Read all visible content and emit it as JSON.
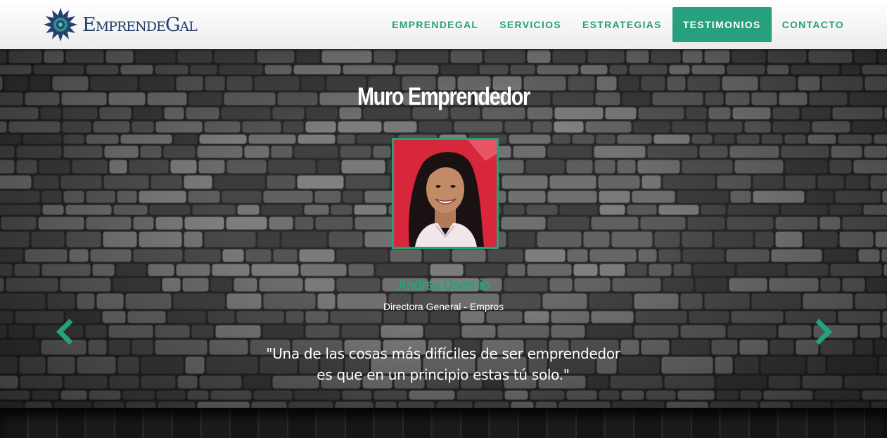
{
  "brand": {
    "name": "EmprendeGal",
    "logo_icon": "mandala-logo-icon"
  },
  "nav": {
    "items": [
      {
        "label": "EMPRENDEGAL",
        "active": false
      },
      {
        "label": "SERVICIOS",
        "active": false
      },
      {
        "label": "ESTRATEGIAS",
        "active": false
      },
      {
        "label": "TESTIMONIOS",
        "active": true
      },
      {
        "label": "CONTACTO",
        "active": false
      }
    ]
  },
  "hero": {
    "title": "Muro Emprendedor",
    "testimonial": {
      "name": "Andrea Osornio",
      "role": "Directora General - Empros",
      "quote_line1": "\"Una de las cosas más difíciles de ser emprendedor",
      "quote_line2": "es que en un principio estas tú solo.\""
    },
    "prev_icon": "chevron-left-icon",
    "next_icon": "chevron-right-icon"
  },
  "colors": {
    "accent": "#27a07d",
    "brand_text": "#233f6b",
    "photo_bg": "#d8273b"
  }
}
